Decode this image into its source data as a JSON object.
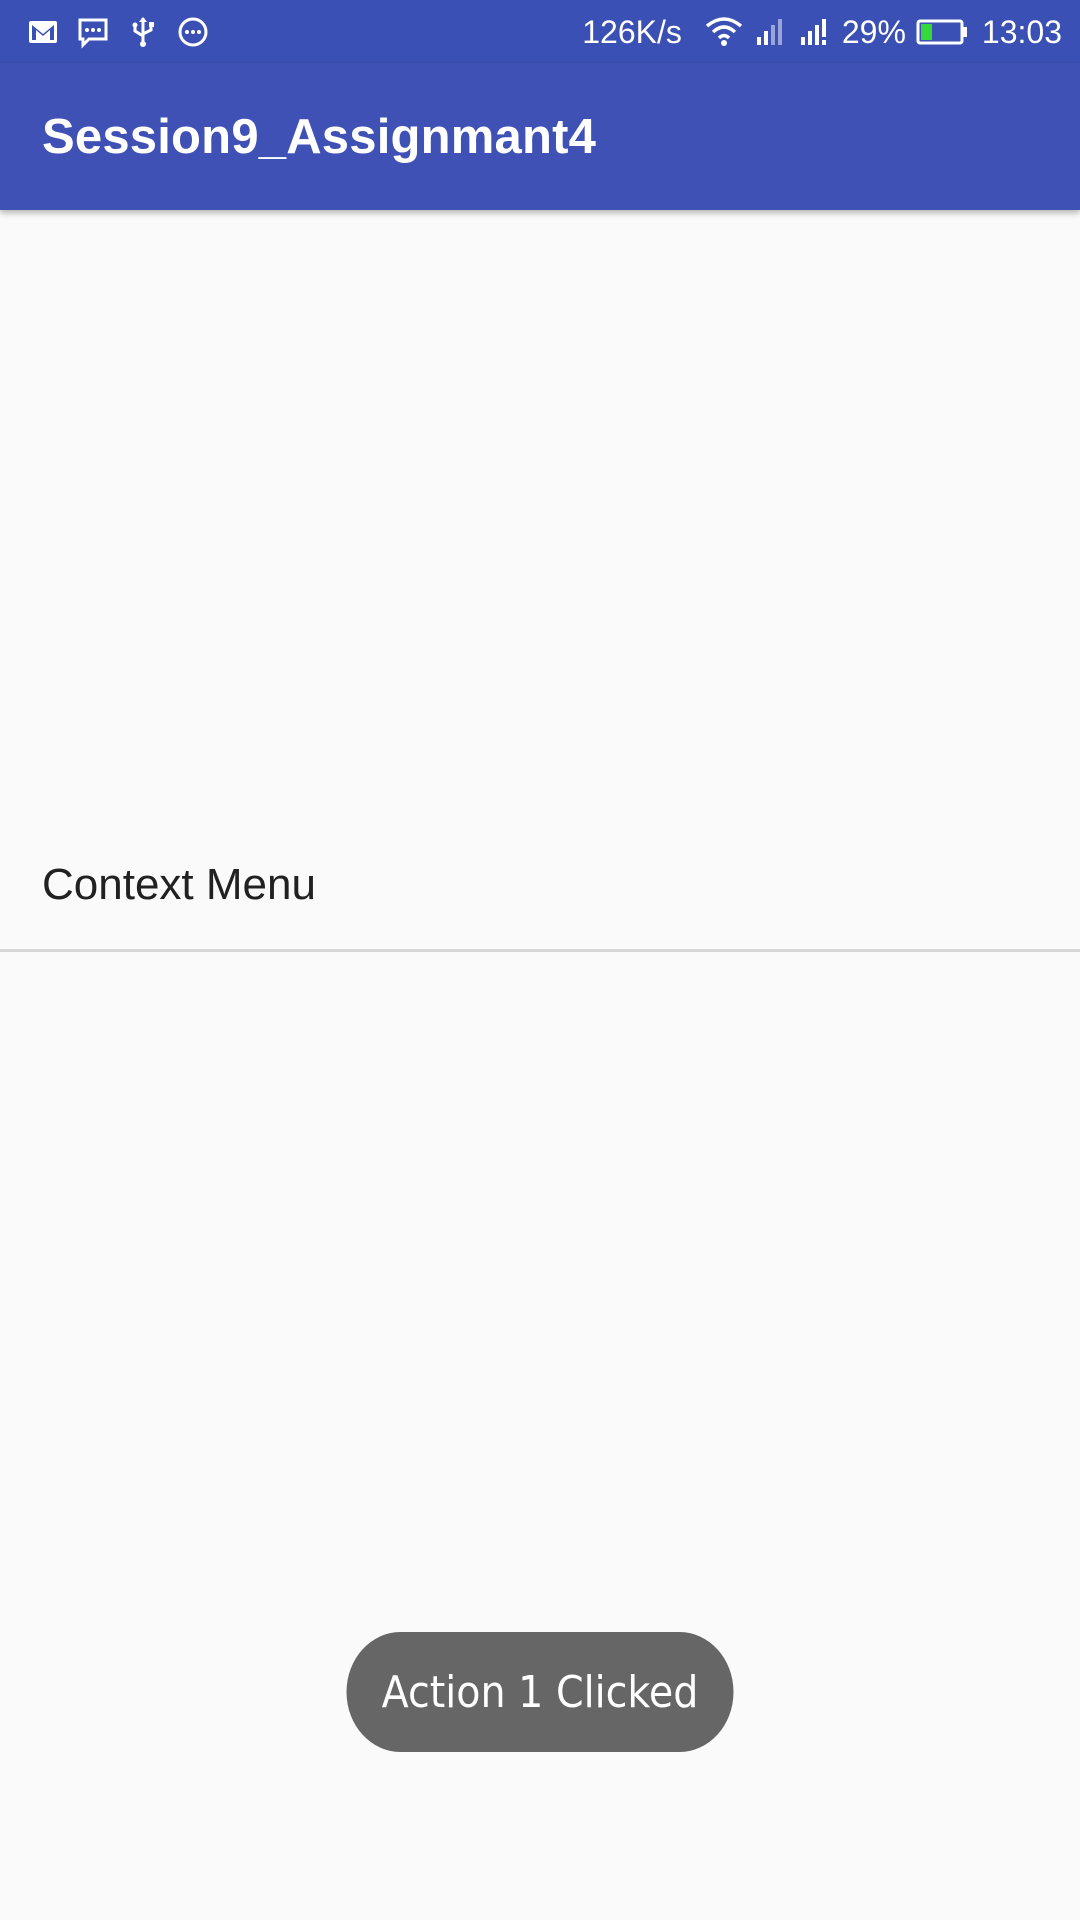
{
  "status_bar": {
    "network_speed": "126K/s",
    "battery_percent": "29%",
    "battery_level": 0.29,
    "time": "13:03",
    "icons_left": [
      "gmail-icon",
      "message-icon",
      "usb-icon",
      "more-icon"
    ],
    "icons_right": [
      "wifi-icon",
      "signal-icon",
      "signal-icon",
      "battery-icon"
    ],
    "battery_color": "#39d83a"
  },
  "app_bar": {
    "title": "Session9_Assignmant4",
    "color": "#3f51b5"
  },
  "content": {
    "context_menu_label": "Context Menu"
  },
  "toast": {
    "message": "Action 1 Clicked"
  }
}
